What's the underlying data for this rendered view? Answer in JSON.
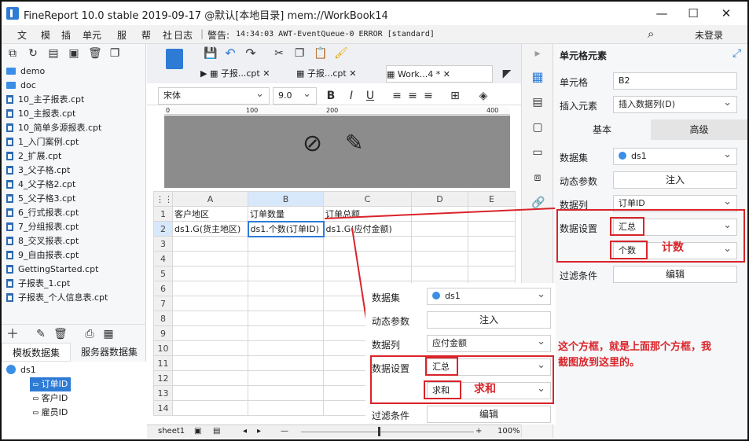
{
  "window": {
    "title": "FineReport 10.0 stable 2019-09-17 @默认[本地目录]    mem://WorkBook14",
    "controls": [
      "—",
      "☐",
      "✕"
    ]
  },
  "menubar": {
    "items": [
      "文",
      "模",
      "插",
      "单元",
      "服",
      "帮",
      "社",
      "日志"
    ],
    "log_prefix": "警告:",
    "log_text": "14:34:03 AWT-EventQueue-0 ERROR [standard]",
    "login_label": "未登录"
  },
  "left": {
    "tree": [
      {
        "type": "folder",
        "label": "demo"
      },
      {
        "type": "folder",
        "label": "doc"
      },
      {
        "type": "file",
        "label": "10_主子报表.cpt"
      },
      {
        "type": "file",
        "label": "10_主报表.cpt"
      },
      {
        "type": "file",
        "label": "10_简单多源报表.cpt"
      },
      {
        "type": "file",
        "label": "1_入门案例.cpt"
      },
      {
        "type": "file",
        "label": "2_扩展.cpt"
      },
      {
        "type": "file",
        "label": "3_父子格.cpt"
      },
      {
        "type": "file",
        "label": "4_父子格2.cpt"
      },
      {
        "type": "file",
        "label": "5_父子格3.cpt"
      },
      {
        "type": "file",
        "label": "6_行式报表.cpt"
      },
      {
        "type": "file",
        "label": "7_分组报表.cpt"
      },
      {
        "type": "file",
        "label": "8_交叉报表.cpt"
      },
      {
        "type": "file",
        "label": "9_自由报表.cpt"
      },
      {
        "type": "file",
        "label": "GettingStarted.cpt"
      },
      {
        "type": "file",
        "label": "子报表_1.cpt"
      },
      {
        "type": "file",
        "label": "子报表_个人信息表.cpt"
      }
    ],
    "dataset_tabs": [
      "模板数据集",
      "服务器数据集"
    ],
    "dataset": {
      "name": "ds1",
      "fields": [
        "订单ID",
        "客户ID",
        "雇员ID"
      ]
    }
  },
  "editor": {
    "tabs": [
      "子报...cpt",
      "子报...cpt",
      "Work...4 *"
    ],
    "font": "宋体",
    "font_size": "9.0",
    "ruler_ticks": [
      "0",
      "100",
      "200",
      "400"
    ],
    "columns": [
      "A",
      "B",
      "C",
      "D",
      "E"
    ],
    "rows": [
      "1",
      "2",
      "3",
      "4",
      "5",
      "6",
      "7",
      "8",
      "9",
      "10",
      "11",
      "12",
      "13",
      "14"
    ],
    "cells": {
      "A1": "客户地区",
      "B1": "订单数量",
      "C1": "订单总额",
      "A2": "ds1.G(货主地区)",
      "B2": "ds1.个数(订单ID)",
      "C2": "ds1.G(应付金额)"
    },
    "sheet_tab": "sheet1",
    "zoom": "100%"
  },
  "right": {
    "header": "单元格元素",
    "cell_label": "单元格",
    "cell_value": "B2",
    "insert_label": "插入元素",
    "insert_value": "插入数据列(D)",
    "tabs": [
      "基本",
      "高级"
    ],
    "dataset_label": "数据集",
    "dataset_value": "ds1",
    "dynamic_label": "动态参数",
    "dynamic_btn": "注入",
    "column_label": "数据列",
    "column_value": "订单ID",
    "setting_label": "数据设置",
    "setting_value": "汇总",
    "setting_sub": "个数",
    "filter_label": "过滤条件",
    "filter_btn": "编辑",
    "annot": "计数"
  },
  "overlay": {
    "dataset_label": "数据集",
    "dataset_value": "ds1",
    "dynamic_label": "动态参数",
    "dynamic_btn": "注入",
    "column_label": "数据列",
    "column_value": "应付金额",
    "setting_label": "数据设置",
    "setting_value": "汇总",
    "setting_sub": "求和",
    "filter_label": "过滤条件",
    "filter_btn": "编辑",
    "annot": "求和"
  },
  "note": "这个方框，就是上面那个方框，我截图放到这里的。"
}
